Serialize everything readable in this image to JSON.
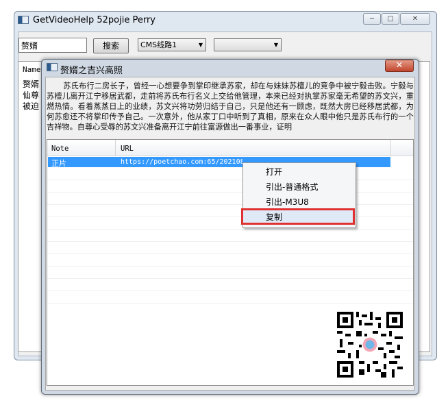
{
  "main_window": {
    "title": "GetVideoHelp    52pojie Perry",
    "min_label": "─",
    "max_label": "□",
    "close_label": "✕"
  },
  "toolbar": {
    "search_value": "赘婿",
    "search_button": "搜索",
    "source_combo": "CMS线路1",
    "second_combo": ""
  },
  "main_list": {
    "name_header": "Name",
    "rows": [
      "赘婿",
      "仙尊",
      "被迫"
    ]
  },
  "dialog": {
    "title": "赘婿之吉兴高照",
    "close_label": "✕",
    "description": "苏氏布行二房长子，曾经一心想要争到掌印继承苏家，却在与妹妹苏檀儿的竞争中被宁毅击败。宁毅与苏檀儿离开江宁移居武都，走前将苏氏布行名义上交给他管理，本来已经对执掌苏家毫无希望的苏文兴，重燃热情。看着蒸蒸日上的业绩，苏文兴将功劳归结于自己，只是他还有一顾虑，既然大房已经移居武都，为何苏愈还不将掌印传予自己。一次意外，他从家丁口中听到了真相，原来在众人眼中他只是苏氏布行的一个吉祥物。自尊心受辱的苏文兴准备离开江宁前往富源做出一番事业，证明",
    "table": {
      "columns": [
        "Note",
        "URL"
      ],
      "rows": [
        {
          "note": "正片",
          "url": "https://poetchao.com:65/20210806/TtJXQ7/index.m3u8"
        }
      ]
    }
  },
  "context_menu": {
    "items": [
      "打开",
      "引出-普通格式",
      "引出-M3U8",
      "复制"
    ],
    "highlighted": "复制",
    "highlight_color": "#e03131"
  },
  "colors": {
    "selection": "#3399ff",
    "close_red": "#c2452c"
  }
}
